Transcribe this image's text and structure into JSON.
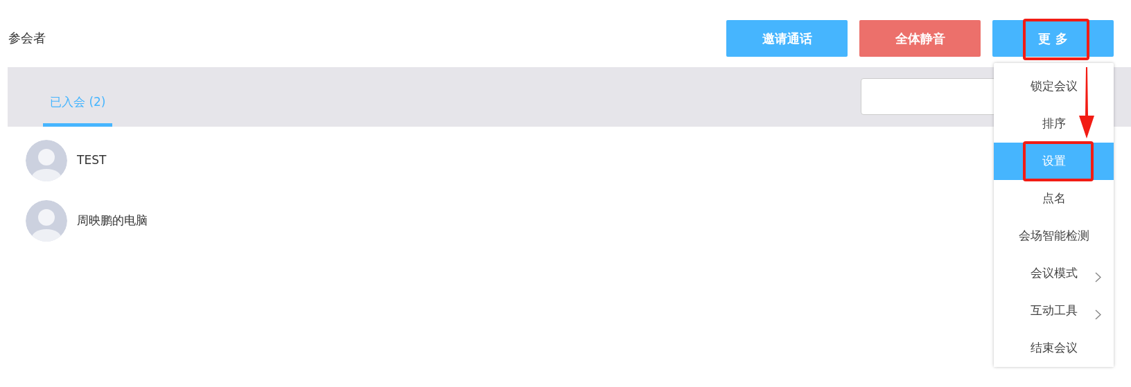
{
  "title": "参会者",
  "actions": [
    {
      "label": "邀请通话",
      "kind": "primary"
    },
    {
      "label": "全体静音",
      "kind": "danger"
    },
    {
      "label": "更 多",
      "kind": "primary",
      "highlighted": true
    }
  ],
  "tabs": [
    {
      "label": "已入会 (2)",
      "selected": true
    }
  ],
  "participants": [
    {
      "name": "TEST"
    },
    {
      "name": "周映鹏的电脑"
    }
  ],
  "more_menu": {
    "items": [
      {
        "label": "锁定会议",
        "selected": false,
        "has_submenu": false,
        "highlighted": false
      },
      {
        "label": "排序",
        "selected": false,
        "has_submenu": false,
        "highlighted": false
      },
      {
        "label": "设置",
        "selected": true,
        "has_submenu": false,
        "highlighted": true
      },
      {
        "label": "点名",
        "selected": false,
        "has_submenu": false,
        "highlighted": false
      },
      {
        "label": "会场智能检测",
        "selected": false,
        "has_submenu": false,
        "highlighted": false
      },
      {
        "label": "会议模式",
        "selected": false,
        "has_submenu": true,
        "highlighted": false
      },
      {
        "label": "互动工具",
        "selected": false,
        "has_submenu": true,
        "highlighted": false
      },
      {
        "label": "结束会议",
        "selected": false,
        "has_submenu": false,
        "highlighted": false
      }
    ]
  }
}
